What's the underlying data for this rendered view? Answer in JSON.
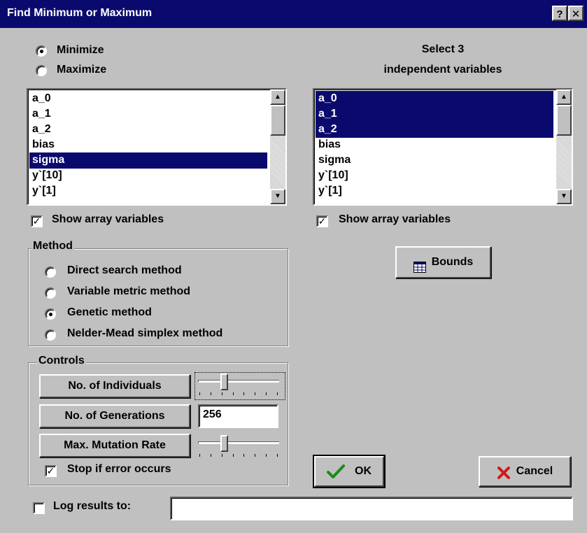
{
  "window": {
    "title": "Find Minimum or Maximum",
    "help_label": "?",
    "close_label": "✕"
  },
  "objective": {
    "options": [
      {
        "label": "Minimize",
        "selected": true
      },
      {
        "label": "Maximize",
        "selected": false
      }
    ]
  },
  "right_header": {
    "line1": "Select 3",
    "line2": "independent variables"
  },
  "left_list": {
    "items": [
      {
        "label": "a_0",
        "selected": false
      },
      {
        "label": "a_1",
        "selected": false
      },
      {
        "label": "a_2",
        "selected": false
      },
      {
        "label": "bias",
        "selected": false
      },
      {
        "label": "sigma",
        "selected": true
      },
      {
        "label": "y`[10]",
        "selected": false
      },
      {
        "label": "y`[1]",
        "selected": false
      }
    ],
    "show_array_label": "Show array variables",
    "show_array_checked": true
  },
  "right_list": {
    "items": [
      {
        "label": "a_0",
        "selected": true
      },
      {
        "label": "a_1",
        "selected": true
      },
      {
        "label": "a_2",
        "selected": true
      },
      {
        "label": "bias",
        "selected": false
      },
      {
        "label": "sigma",
        "selected": false
      },
      {
        "label": "y`[10]",
        "selected": false
      },
      {
        "label": "y`[1]",
        "selected": false
      }
    ],
    "show_array_label": "Show array variables",
    "show_array_checked": true
  },
  "method": {
    "title": "Method",
    "options": [
      {
        "label": "Direct search method",
        "selected": false
      },
      {
        "label": "Variable metric method",
        "selected": false
      },
      {
        "label": "Genetic method",
        "selected": true
      },
      {
        "label": "Nelder-Mead simplex method",
        "selected": false
      }
    ]
  },
  "bounds_button": {
    "label": "Bounds",
    "icon": "table-icon"
  },
  "controls": {
    "title": "Controls",
    "individuals_label": "No. of Individuals",
    "individuals_level": 0.3,
    "generations_label": "No. of Generations",
    "generations_value": "256",
    "mutation_label": "Max. Mutation Rate",
    "mutation_level": 0.3,
    "stop_label": "Stop if error occurs",
    "stop_checked": true
  },
  "ok_button": {
    "label": "OK",
    "icon": "checkmark-icon",
    "accent": "#1a8a1a"
  },
  "cancel_button": {
    "label": "Cancel",
    "icon": "x-icon",
    "accent": "#cc1a1a"
  },
  "log": {
    "label": "Log results to:",
    "checked": false,
    "value": ""
  },
  "colors": {
    "titlebar": "#0a0a6e",
    "selection": "#0a0a6e",
    "face": "#c0c0c0"
  }
}
